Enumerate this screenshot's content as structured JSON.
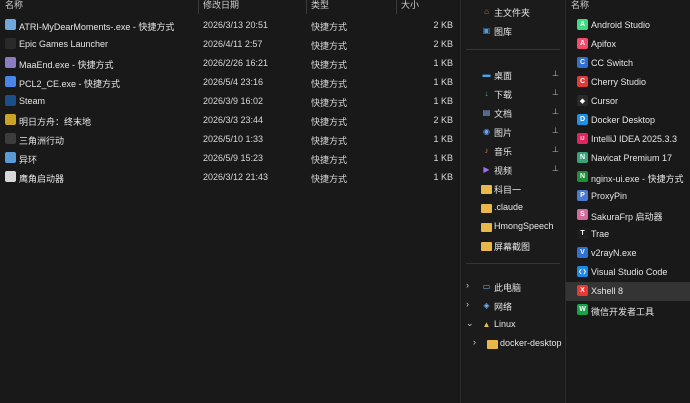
{
  "left": {
    "headers": {
      "name": "名称",
      "date": "修改日期",
      "type": "类型",
      "size": "大小"
    },
    "files": [
      {
        "name": "ATRI-MyDearMoments-.exe - 快捷方式",
        "date": "2026/3/13 20:51",
        "type": "快捷方式",
        "size": "2 KB",
        "icon": "atri-app-icon",
        "color": "#6fa8dc"
      },
      {
        "name": "Epic Games Launcher",
        "date": "2026/4/11 2:57",
        "type": "快捷方式",
        "size": "2 KB",
        "icon": "epic-games-icon",
        "color": "#2a2a2a"
      },
      {
        "name": "MaaEnd.exe - 快捷方式",
        "date": "2026/2/26 16:21",
        "type": "快捷方式",
        "size": "1 KB",
        "icon": "maaend-icon",
        "color": "#8e7cc3"
      },
      {
        "name": "PCL2_CE.exe - 快捷方式",
        "date": "2026/5/4 23:16",
        "type": "快捷方式",
        "size": "1 KB",
        "icon": "pcl2-icon",
        "color": "#4a86e8"
      },
      {
        "name": "Steam",
        "date": "2026/3/9 16:02",
        "type": "快捷方式",
        "size": "1 KB",
        "icon": "steam-icon",
        "color": "#1b4e8a"
      },
      {
        "name": "明日方舟：终末地",
        "date": "2026/3/3 23:44",
        "type": "快捷方式",
        "size": "2 KB",
        "icon": "arknights-endfield-icon",
        "color": "#c9a227"
      },
      {
        "name": "三角洲行动",
        "date": "2026/5/10 1:33",
        "type": "快捷方式",
        "size": "1 KB",
        "icon": "delta-force-icon",
        "color": "#3c3c3c"
      },
      {
        "name": "异环",
        "date": "2026/5/9 15:23",
        "type": "快捷方式",
        "size": "1 KB",
        "icon": "neverness-icon",
        "color": "#5a9bd5"
      },
      {
        "name": "鹰角启动器",
        "date": "2026/3/12 21:43",
        "type": "快捷方式",
        "size": "1 KB",
        "icon": "hypergryph-launcher-icon",
        "color": "#d8d8d8"
      }
    ]
  },
  "mid": {
    "top": [
      {
        "label": "主文件夹",
        "icon": "home-icon"
      },
      {
        "label": "图库",
        "icon": "gallery-icon"
      }
    ],
    "quick": [
      {
        "label": "桌面",
        "icon": "desktop-icon",
        "pinned": true
      },
      {
        "label": "下载",
        "icon": "download-icon",
        "pinned": true
      },
      {
        "label": "文档",
        "icon": "documents-icon",
        "pinned": true
      },
      {
        "label": "图片",
        "icon": "pictures-icon",
        "pinned": true
      },
      {
        "label": "音乐",
        "icon": "music-icon",
        "pinned": true
      },
      {
        "label": "视频",
        "icon": "videos-icon",
        "pinned": true
      },
      {
        "label": "科目一",
        "icon": "folder-icon",
        "pinned": false
      },
      {
        "label": ".claude",
        "icon": "folder-icon",
        "pinned": false
      },
      {
        "label": "HmongSpeech",
        "icon": "folder-icon",
        "pinned": false
      },
      {
        "label": "屏幕截图",
        "icon": "folder-icon",
        "pinned": false
      }
    ],
    "tree": [
      {
        "label": "此电脑",
        "icon": "this-pc-icon",
        "chev": "›"
      },
      {
        "label": "网络",
        "icon": "network-icon",
        "chev": "›"
      },
      {
        "label": "Linux",
        "icon": "linux-icon",
        "chev": "⌄"
      },
      {
        "label": "docker-desktop",
        "icon": "folder-icon",
        "chev": "›"
      }
    ],
    "pin_glyph": "📌"
  },
  "right": {
    "header": "名称",
    "apps": [
      {
        "label": "Android Studio",
        "icon": "android-studio-icon",
        "color": "#3ddc84",
        "glyph": "A"
      },
      {
        "label": "Apifox",
        "icon": "apifox-icon",
        "color": "#f44a6b",
        "glyph": "A"
      },
      {
        "label": "CC Switch",
        "icon": "cc-switch-icon",
        "color": "#2f6fd6",
        "glyph": "C"
      },
      {
        "label": "Cherry Studio",
        "icon": "cherry-studio-icon",
        "color": "#e03a3a",
        "glyph": "C"
      },
      {
        "label": "Cursor",
        "icon": "cursor-icon",
        "color": "#2a2a2a",
        "glyph": "◆"
      },
      {
        "label": "Docker Desktop",
        "icon": "docker-icon",
        "color": "#1d91e6",
        "glyph": "D"
      },
      {
        "label": "IntelliJ IDEA 2025.3.3",
        "icon": "intellij-icon",
        "color": "#e3245f",
        "glyph": "IJ"
      },
      {
        "label": "Navicat Premium 17",
        "icon": "navicat-icon",
        "color": "#3aa37c",
        "glyph": "N"
      },
      {
        "label": "nginx-ui.exe - 快捷方式",
        "icon": "nginx-ui-icon",
        "color": "#1f8f3c",
        "glyph": "N"
      },
      {
        "label": "ProxyPin",
        "icon": "proxypin-icon",
        "color": "#4a7bd0",
        "glyph": "P"
      },
      {
        "label": "SakuraFrp 启动器",
        "icon": "sakurafrp-icon",
        "color": "#d46a9a",
        "glyph": "S"
      },
      {
        "label": "Trae",
        "icon": "trae-icon",
        "color": "#1e1e1e",
        "glyph": "T"
      },
      {
        "label": "v2rayN.exe",
        "icon": "v2rayn-icon",
        "color": "#2f6fd6",
        "glyph": "V"
      },
      {
        "label": "Visual Studio Code",
        "icon": "vscode-icon",
        "color": "#1e88e5",
        "glyph": "❮❯"
      },
      {
        "label": "Xshell 8",
        "icon": "xshell-icon",
        "color": "#e53935",
        "glyph": "X"
      },
      {
        "label": "微信开发者工具",
        "icon": "wechat-devtools-icon",
        "color": "#16a34a",
        "glyph": "W"
      }
    ],
    "selected_index": 14
  }
}
